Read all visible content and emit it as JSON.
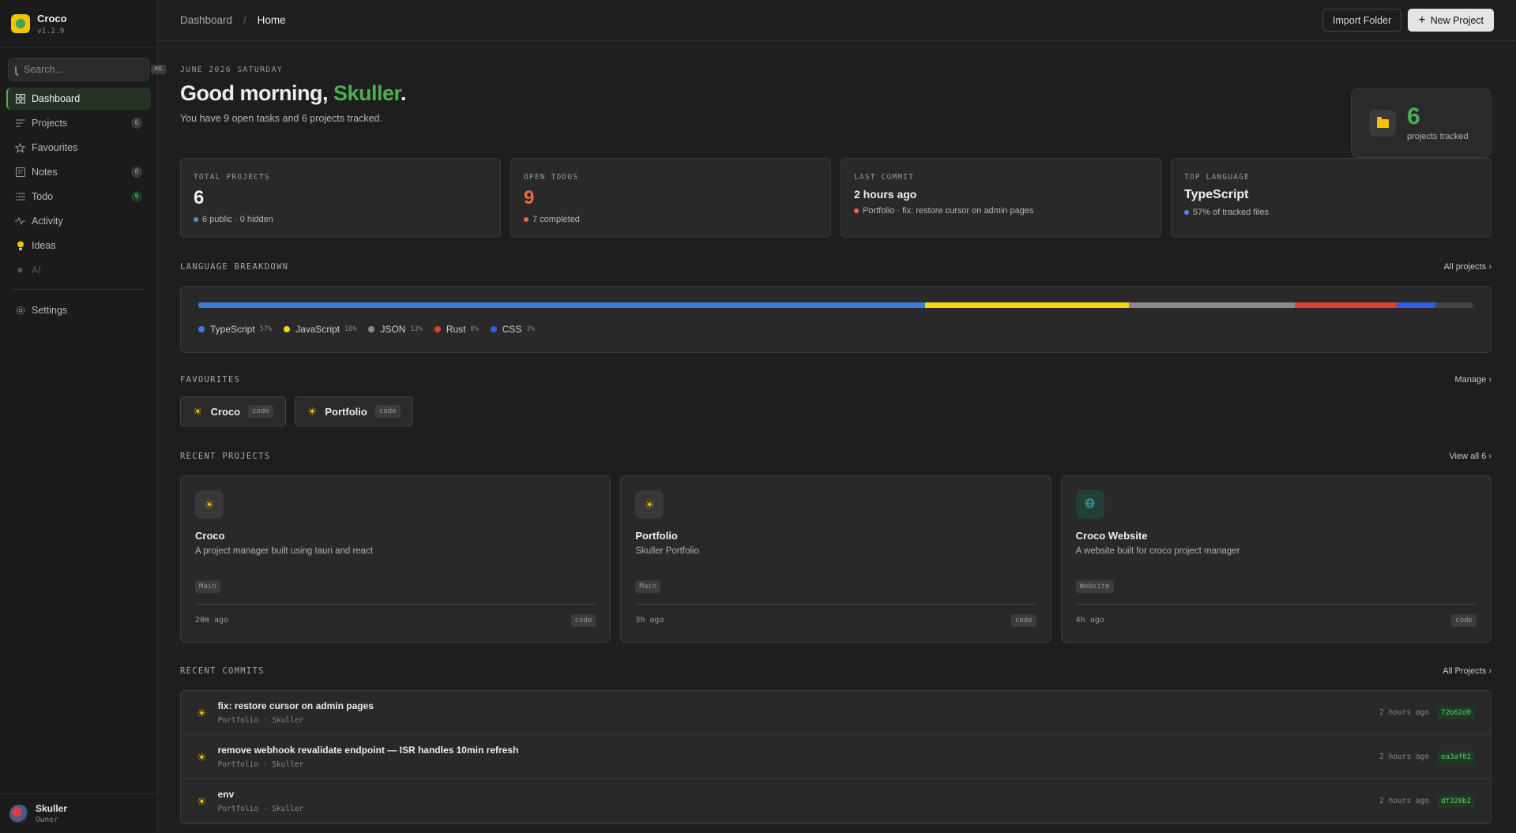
{
  "app": {
    "name": "Croco",
    "version": "v1.2.9"
  },
  "search": {
    "placeholder": "Search...",
    "shortcut": "⌘K"
  },
  "sidebar": {
    "items": [
      {
        "label": "Dashboard",
        "badge": ""
      },
      {
        "label": "Projects",
        "badge": "6"
      },
      {
        "label": "Favourites",
        "badge": ""
      },
      {
        "label": "Notes",
        "badge": "0"
      },
      {
        "label": "Todo",
        "badge": "9"
      },
      {
        "label": "Activity",
        "badge": ""
      },
      {
        "label": "Ideas",
        "badge": ""
      },
      {
        "label": "AI",
        "badge": ""
      }
    ],
    "settings": "Settings"
  },
  "user": {
    "name": "Skuller",
    "role": "Owner"
  },
  "breadcrumb": {
    "root": "Dashboard",
    "sep": "/",
    "current": "Home"
  },
  "toolbar": {
    "import_label": "Import Folder",
    "new_label": "New Project"
  },
  "hero": {
    "date": "JUNE 2026 SATURDAY",
    "greeting": "Good morning, ",
    "name": "Skuller",
    "punct": ".",
    "subtitle": "You have 9 open tasks and 6 projects tracked."
  },
  "tracked": {
    "count": "6",
    "label": "projects tracked"
  },
  "stats": [
    {
      "label": "TOTAL PROJECTS",
      "value": "6",
      "sub": "6 public · 0 hidden",
      "dot": "#4a8fe0"
    },
    {
      "label": "OPEN TODOS",
      "value": "9",
      "sub": "7 completed",
      "dot": "#ef6c3a"
    },
    {
      "label": "LAST COMMIT",
      "value": "2 hours ago",
      "sub": "Portfolio · fix: restore cursor on admin pages",
      "dot": "#ef6c3a"
    },
    {
      "label": "TOP LANGUAGE",
      "value": "TypeScript",
      "sub": "57% of tracked files",
      "dot": "#4a8fe0"
    }
  ],
  "languages": {
    "title": "LANGUAGE BREAKDOWN",
    "link": "All projects ›",
    "items": [
      {
        "name": "TypeScript",
        "pct": 57,
        "label": "57%",
        "color": "#3b7dd8"
      },
      {
        "name": "JavaScript",
        "pct": 16,
        "label": "16%",
        "color": "#f2d70f"
      },
      {
        "name": "JSON",
        "pct": 13,
        "label": "13%",
        "color": "#8a8a8a"
      },
      {
        "name": "Rust",
        "pct": 8,
        "label": "8%",
        "color": "#d9442b"
      },
      {
        "name": "CSS",
        "pct": 3,
        "label": "3%",
        "color": "#2e5ee6"
      }
    ]
  },
  "favourites": {
    "title": "FAVOURITES",
    "link": "Manage ›",
    "items": [
      {
        "name": "Croco",
        "tag": "code"
      },
      {
        "name": "Portfolio",
        "tag": "code"
      }
    ]
  },
  "recent_projects": {
    "title": "RECENT PROJECTS",
    "link": "View all 6 ›",
    "items": [
      {
        "name": "Croco",
        "desc": "A project manager built using tauri and react",
        "tag": "Main",
        "time": "20m ago",
        "type": "code",
        "icon": "sun-icon"
      },
      {
        "name": "Portfolio",
        "desc": "Skuller Portfolio",
        "tag": "Main",
        "time": "3h ago",
        "type": "code",
        "icon": "sun-icon"
      },
      {
        "name": "Croco Website",
        "desc": "A website built for croco project manager",
        "tag": "Website",
        "time": "4h ago",
        "type": "code",
        "icon": "globe-icon"
      }
    ]
  },
  "recent_commits": {
    "title": "RECENT COMMITS",
    "link": "All Projects ›",
    "items": [
      {
        "msg": "fix: restore cursor on admin pages",
        "meta": "Portfolio · Skuller",
        "time": "2 hours ago",
        "hash": "72b62d0"
      },
      {
        "msg": "remove webhook revalidate endpoint — ISR handles 10min refresh",
        "meta": "Portfolio · Skuller",
        "time": "2 hours ago",
        "hash": "ea3af02"
      },
      {
        "msg": "env",
        "meta": "Portfolio · Skuller",
        "time": "2 hours ago",
        "hash": "df320b2"
      }
    ]
  },
  "colors": {
    "accent": "#4caf50",
    "warning": "#ef6c3a",
    "brand": "#f5c400"
  }
}
